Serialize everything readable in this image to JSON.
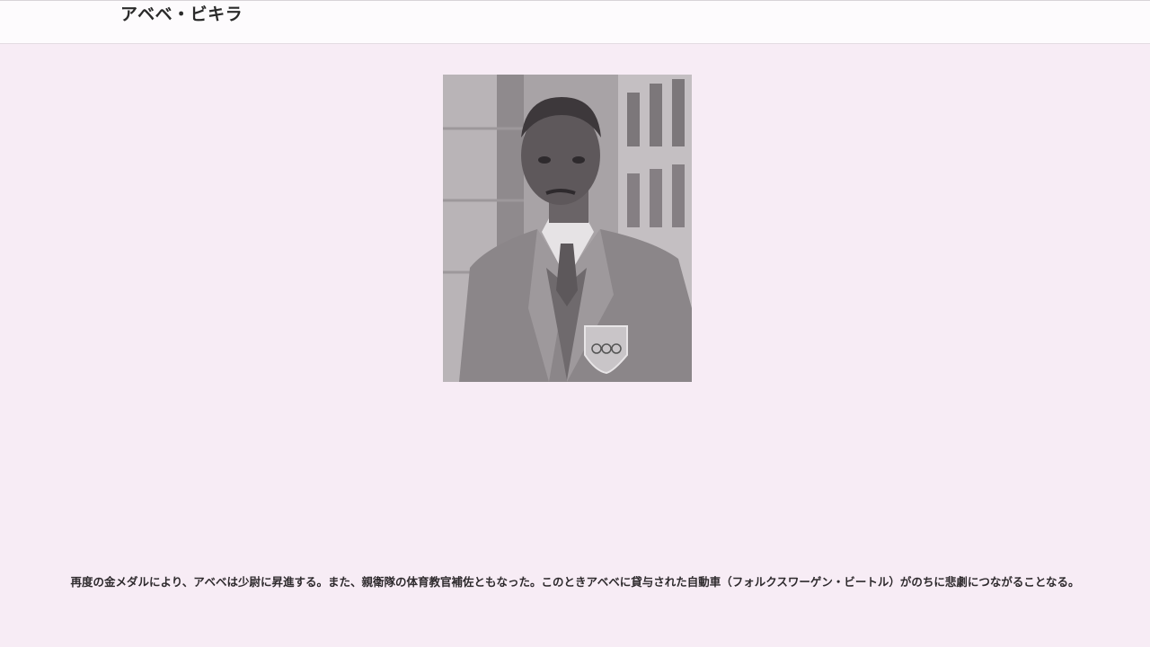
{
  "header": {
    "title": "アベベ・ビキラ"
  },
  "main": {
    "photo": {
      "alt": "アベベ・ビキラ"
    },
    "caption": "再度の金メダルにより、アベベは少尉に昇進する。また、親衛隊の体育教官補佐ともなった。このときアベベに貸与された自動車（フォルクスワーゲン・ビートル）がのちに悲劇につながることなる。"
  },
  "colors": {
    "background": "#f7ecf5",
    "header_background": "#fdfbfd",
    "text": "#2a2a2a"
  }
}
